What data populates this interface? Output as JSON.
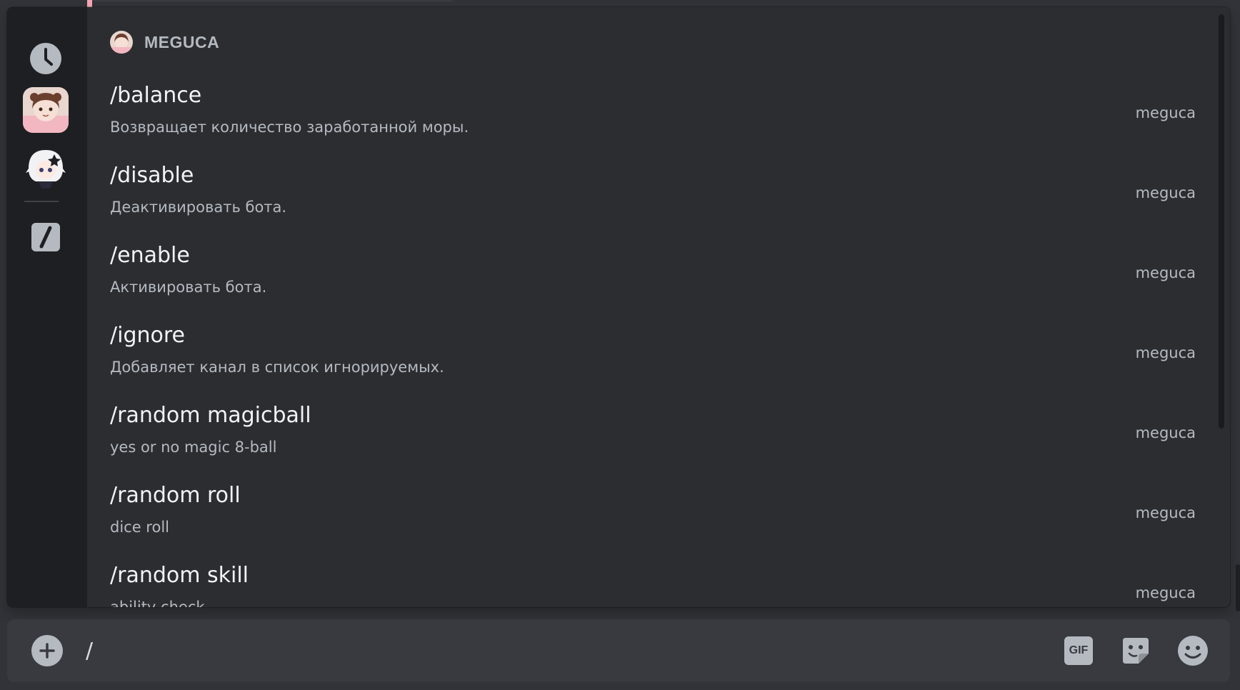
{
  "rail": {
    "items": [
      {
        "name": "recent-icon"
      },
      {
        "name": "meguca-app-icon"
      },
      {
        "name": "bot-app-icon"
      },
      {
        "name": "built-in-commands-icon"
      }
    ]
  },
  "section": {
    "name": "MEGUCA"
  },
  "commands": [
    {
      "title": "/balance",
      "description": "Возвращает количество заработанной моры.",
      "source": "meguca"
    },
    {
      "title": "/disable",
      "description": "Деактивировать бота.",
      "source": "meguca"
    },
    {
      "title": "/enable",
      "description": "Активировать бота.",
      "source": "meguca"
    },
    {
      "title": "/ignore",
      "description": "Добавляет канал в список игнорируемых.",
      "source": "meguca"
    },
    {
      "title": "/random magicball",
      "description": "yes or no magic 8-ball",
      "source": "meguca"
    },
    {
      "title": "/random roll",
      "description": "dice roll",
      "source": "meguca"
    },
    {
      "title": "/random skill",
      "description": "ability check",
      "source": "meguca"
    }
  ],
  "composer": {
    "value": "/",
    "gif_label": "GIF"
  },
  "colors": {
    "background": "#313338",
    "popup": "#2b2d31",
    "rail": "#1e1f22",
    "text_primary": "#f2f3f5",
    "text_muted": "#b5bac1"
  }
}
